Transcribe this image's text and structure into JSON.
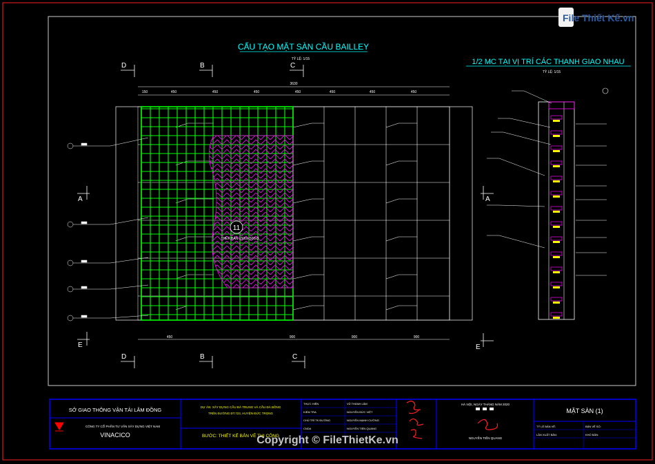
{
  "watermark": {
    "logo_text": "File Thiết Kế.vn",
    "copyright": "Copyright © FileThietKe.vn"
  },
  "plan": {
    "title": "CẤU TẠO MẶT SÀN CẦU BAILLEY",
    "scale": "TỶ LỆ: 1/15",
    "section_labels": [
      "D",
      "B",
      "C",
      "A",
      "E"
    ],
    "overall_dim": "3630",
    "top_dims": [
      "150",
      "450",
      "450",
      "450",
      "450",
      "450",
      "450",
      "450"
    ],
    "bottom_dims": [
      "450",
      "900",
      "900",
      "900"
    ],
    "callout": "11",
    "hatch_label": "THÉP BẢN 1500x 500x3"
  },
  "section": {
    "title": "1/2 MC TẠI VỊ TRÍ CÁC THANH GIAO NHAU",
    "scale": "TỶ LỆ: 1/15"
  },
  "title_block": {
    "org": "SỞ GIAO THÔNG VẬN TẢI LÂM ĐỒNG",
    "company": "CÔNG TY CỔ PHẦN TƯ VẤN XÂY DỰNG VIỆT NAM",
    "company_short": "VINACICO",
    "project_line1": "DỰ ÁN: XÂY DỰNG CẦU ĐÀ TRUNG VÀ CẦU ĐÀ BỒNG",
    "project_line2": "TRÊN ĐƯỜNG ĐT.723, HUYỆN ĐỨC TRỌNG",
    "phase": "BƯỚC: THIẾT KẾ BẢN VẼ THI CÔNG",
    "roles": [
      "THỰC HIỆN",
      "KIỂM TRA",
      "CHỦ TRÌ TK ĐƯỜNG",
      "CNDA"
    ],
    "names": [
      "VŨ THÀNH LÂM",
      "NGUYỄN ĐỨC VIỆT",
      "NGUYỄN MẠNH CƯỜNG",
      "NGUYỄN TIẾN QUANG"
    ],
    "date_line": "HÀ NỘI, NGÀY    THÁNG    NĂM 2020",
    "signer": "NGUYỄN TIẾN QUANG",
    "sheet_title": "MẶT SÀN (1)",
    "ratio_label": "TỶ LỆ BẢN VẼ:",
    "sheet_no_label": "BẢN VẼ SỐ:",
    "issue_label": "LẦN XUẤT BẢN:",
    "file_label": "KHỔ BẢN:"
  },
  "colors": {
    "frame": "#0000ff",
    "border": "#ff0000",
    "green": "#00ff00",
    "magenta": "#ff00ff",
    "cyan": "#00ffff",
    "white": "#ffffff"
  }
}
